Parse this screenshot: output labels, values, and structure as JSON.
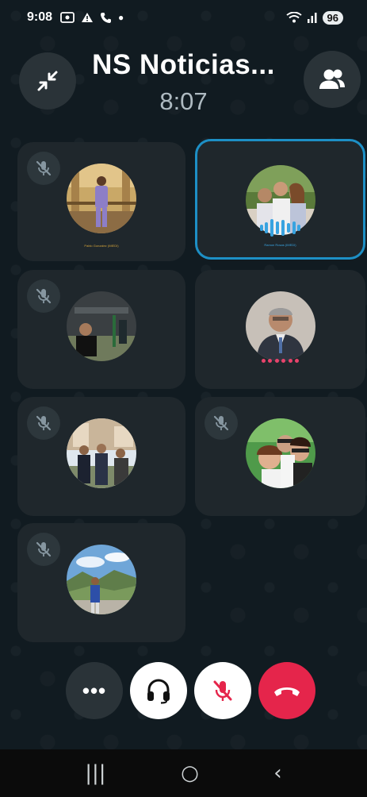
{
  "status_bar": {
    "time": "9:08",
    "battery": "96"
  },
  "call": {
    "title": "NS Noticias...",
    "timer": "8:07"
  },
  "participants": [
    {
      "name": "Pablo Gonzalez (IMEDI)",
      "muted": true,
      "active": false
    },
    {
      "name": "Ramon Rosas (IMEDI)",
      "muted": false,
      "active": true
    },
    {
      "name": "",
      "muted": true,
      "active": false
    },
    {
      "name": "",
      "muted": false,
      "active": false
    },
    {
      "name": "",
      "muted": true,
      "active": false
    },
    {
      "name": "",
      "muted": true,
      "active": false
    },
    {
      "name": "",
      "muted": true,
      "active": false
    }
  ],
  "controls": {
    "more_label": "•••"
  },
  "colors": {
    "background": "#111b21",
    "tile": "#1f272c",
    "active_border": "#1d8fc5",
    "end_call": "#e5254b",
    "waveform": "#38a3e0"
  }
}
